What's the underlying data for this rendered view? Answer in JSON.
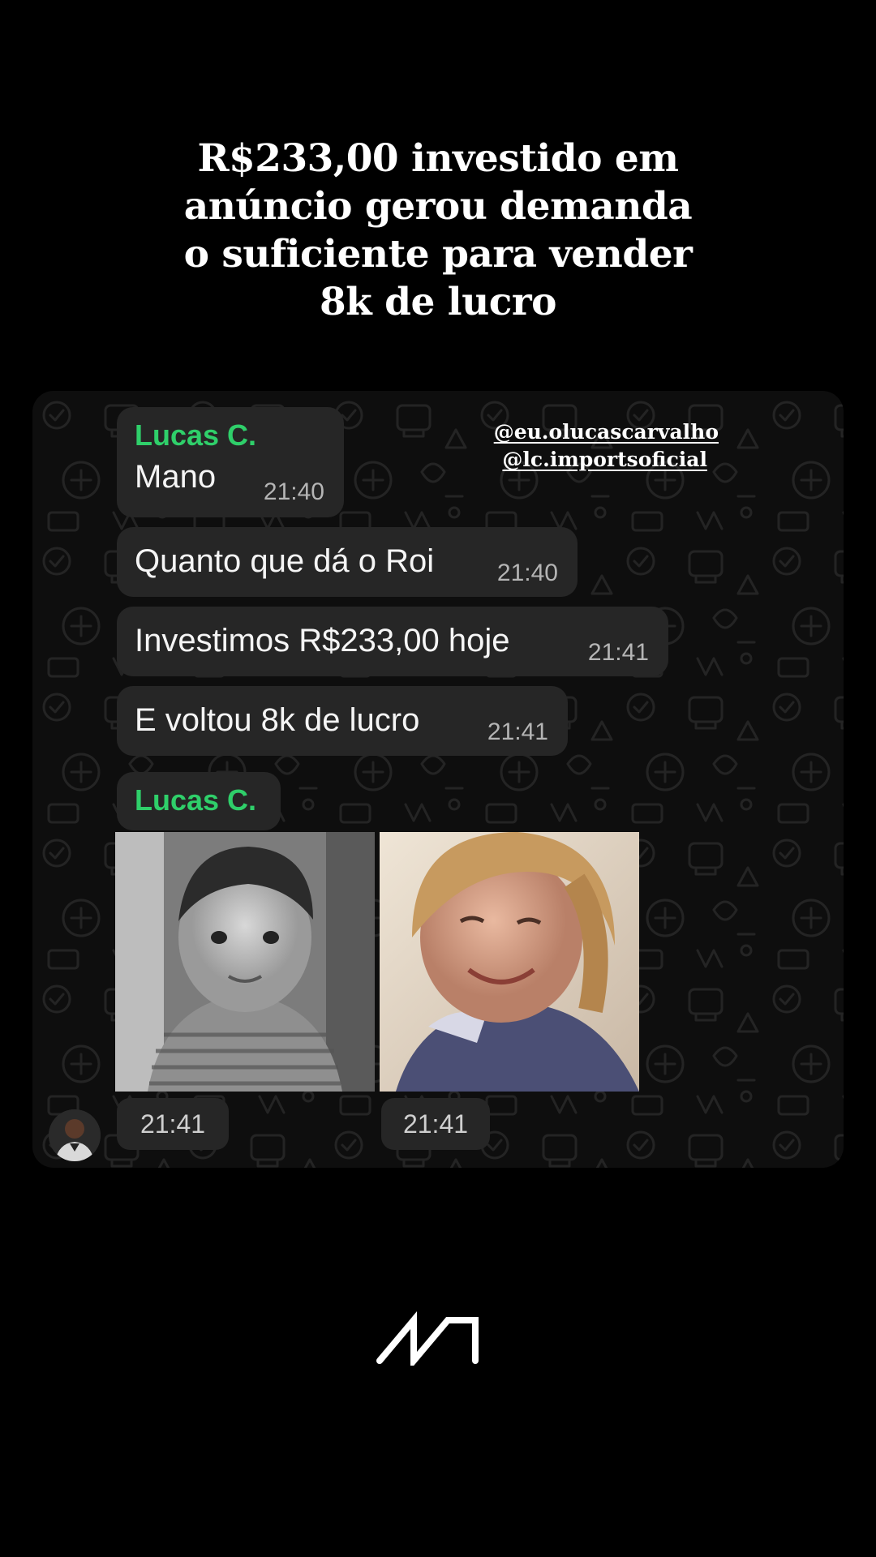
{
  "headline": {
    "lines": [
      "R$233,00 investido em",
      "anúncio gerou demanda",
      "o suficiente para vender",
      "8k de lucro"
    ]
  },
  "handles": {
    "primary": "@eu.olucascarvalho",
    "secondary": "@lc.importsoficial"
  },
  "chat": {
    "messages": [
      {
        "sender": "Lucas C.",
        "text": "Mano",
        "time": "21:40"
      },
      {
        "text": "Quanto que dá o Roi",
        "time": "21:40"
      },
      {
        "text": "Investimos R$233,00 hoje",
        "time": "21:41"
      },
      {
        "text": "E voltou 8k de lucro",
        "time": "21:41"
      }
    ],
    "media_sender": "Lucas C.",
    "media_times": [
      "21:41",
      "21:41"
    ]
  },
  "colors": {
    "background": "#000000",
    "bubble": "#262626",
    "sender_name": "#2fcf6a"
  },
  "icons": {
    "logo": "m-logo",
    "avatar": "user-avatar",
    "wallpaper": "chat-doodle-pattern"
  }
}
